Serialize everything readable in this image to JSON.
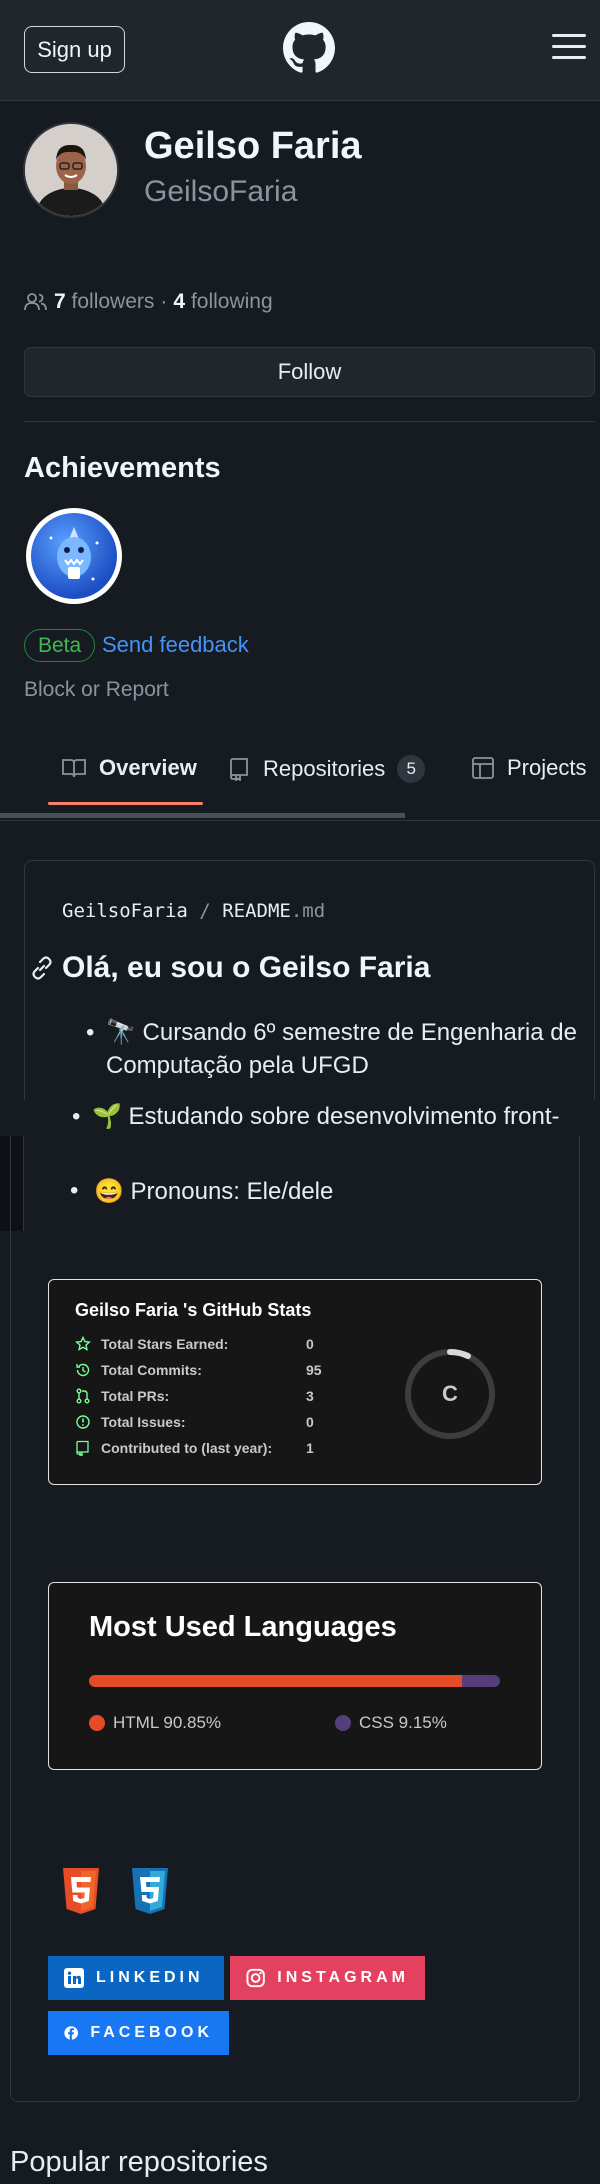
{
  "header": {
    "signup_label": "Sign up"
  },
  "profile": {
    "name": "Geilso Faria",
    "login": "GeilsoFaria",
    "followers_count": "7",
    "followers_label": "followers",
    "sep": "·",
    "following_count": "4",
    "following_label": "following",
    "follow_label": "Follow"
  },
  "achievements": {
    "title": "Achievements",
    "beta_label": "Beta",
    "feedback_label": "Send feedback",
    "block_label": "Block or Report"
  },
  "tabs": [
    {
      "label": "Overview"
    },
    {
      "label": "Repositories",
      "count": "5"
    },
    {
      "label": "Projects"
    }
  ],
  "readme": {
    "owner": "GeilsoFaria",
    "slash": "/",
    "file": "README",
    "ext": ".md",
    "heading": "Olá, eu sou o Geilso Faria",
    "items": [
      "🔭 Cursando 6º semestre de Engenharia de Computação pela UFGD",
      "🌱 Estudando sobre desenvolvimento front-end",
      "😄 Pronouns: Ele/dele"
    ]
  },
  "stats_card": {
    "title": "Geilso Faria 's GitHub Stats",
    "rows": [
      {
        "label": "Total Stars Earned:",
        "value": "0",
        "icon": "star-icon"
      },
      {
        "label": "Total Commits:",
        "value": "95",
        "icon": "history-icon"
      },
      {
        "label": "Total PRs:",
        "value": "3",
        "icon": "pull-request-icon"
      },
      {
        "label": "Total Issues:",
        "value": "0",
        "icon": "issue-icon"
      },
      {
        "label": "Contributed to (last year):",
        "value": "1",
        "icon": "repo-icon"
      }
    ],
    "rank": "C",
    "colors": {
      "accent": "#79ff97",
      "ring": "#fe428e"
    }
  },
  "languages_card": {
    "title": "Most Used Languages",
    "langs": [
      {
        "name": "HTML",
        "percent": 90.85,
        "text": "HTML 90.85%",
        "color": "#e34c26"
      },
      {
        "name": "CSS",
        "percent": 9.15,
        "text": "CSS 9.15%",
        "color": "#563d7c"
      }
    ]
  },
  "tech_icons": [
    "html5-icon",
    "css3-icon"
  ],
  "social": [
    {
      "label": "LINKEDIN",
      "color": "#0a66c2",
      "icon": "linkedin-icon"
    },
    {
      "label": "INSTAGRAM",
      "color": "#e4405f",
      "icon": "instagram-icon"
    },
    {
      "label": "FACEBOOK",
      "color": "#1877f2",
      "icon": "facebook-icon"
    }
  ],
  "popular": {
    "title": "Popular repositories"
  }
}
